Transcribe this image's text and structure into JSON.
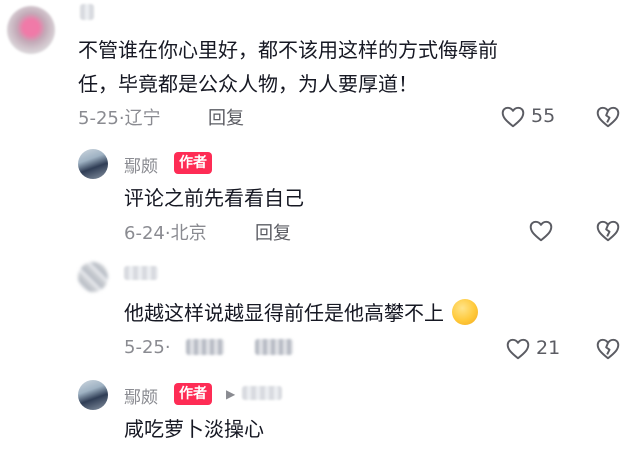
{
  "comments": [
    {
      "text_line1": "不管谁在你心里好，都不该用这样的方式侮辱前",
      "text_line2": "任，毕竟都是公众人物，为人要厚道！",
      "date": "5-25",
      "location": "辽宁",
      "reply_label": "回复",
      "likes": "55"
    },
    {
      "author": "鄢颇",
      "badge": "作者",
      "text": "评论之前先看看自己",
      "date": "6-24",
      "location": "北京",
      "reply_label": "回复"
    },
    {
      "text": "他越这样说越显得前任是他高攀不上",
      "date": "5-25",
      "likes": "21"
    },
    {
      "author": "鄢颇",
      "badge": "作者",
      "text": "咸吃萝卜淡操心"
    }
  ],
  "separator": "·",
  "icons": {
    "like": "heart-outline-icon",
    "dislike": "broken-heart-icon",
    "reply_arrow": "triangle-right-icon",
    "emoji": "smirk-emoji-icon"
  },
  "colors": {
    "author_badge": "#fe2c55",
    "meta_text": "#8a8b91",
    "body_text": "#161823"
  }
}
